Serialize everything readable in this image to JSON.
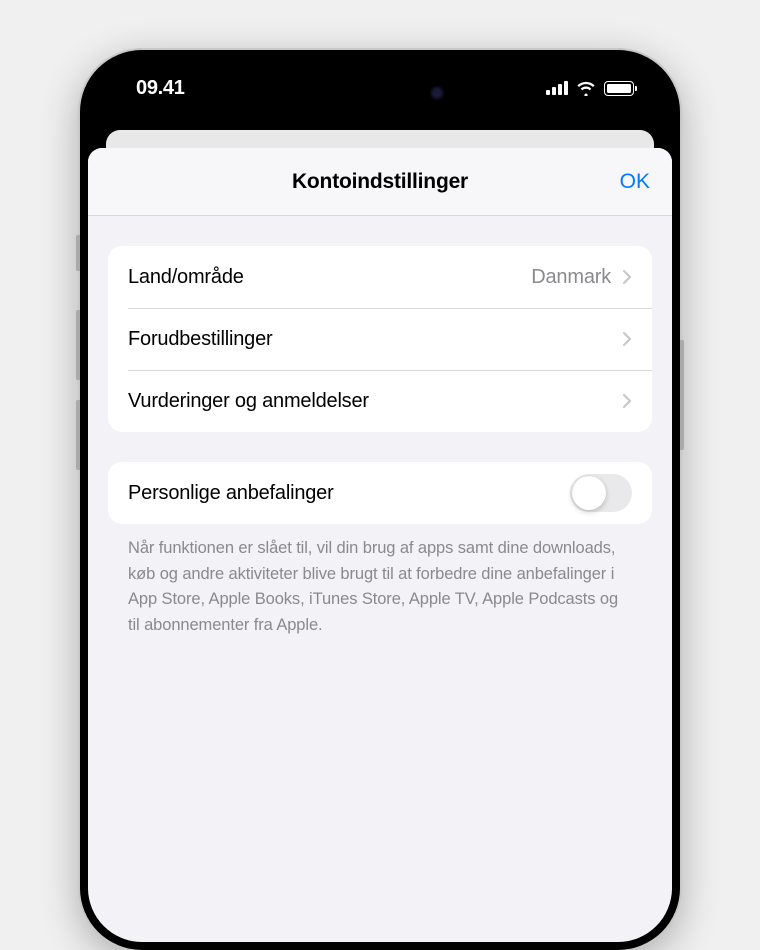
{
  "status_bar": {
    "time": "09.41"
  },
  "modal": {
    "title": "Kontoindstillinger",
    "done_label": "OK"
  },
  "rows": {
    "country": {
      "label": "Land/område",
      "value": "Danmark"
    },
    "preorders": {
      "label": "Forudbestillinger"
    },
    "ratings": {
      "label": "Vurderinger og anmeldelser"
    },
    "recommendations": {
      "label": "Personlige anbefalinger",
      "enabled": false
    }
  },
  "footer_text": "Når funktionen er slået til, vil din brug af apps samt dine downloads, køb og andre aktiviteter blive brugt til at forbedre dine anbefalinger i App Store, Apple Books, iTunes Store, Apple TV, Apple Podcasts og til abonnementer fra Apple."
}
